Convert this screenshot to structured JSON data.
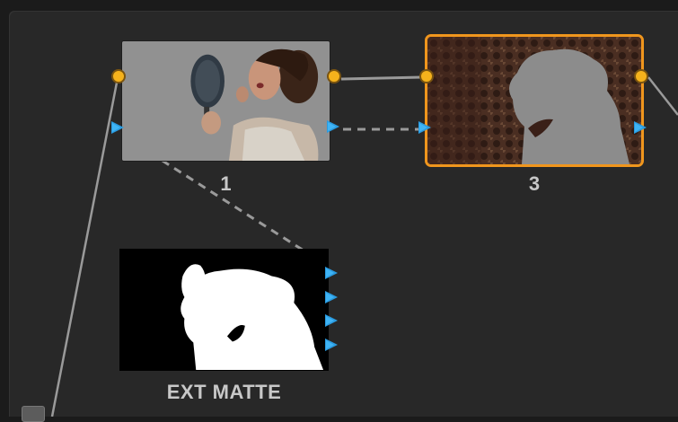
{
  "nodes": [
    {
      "id": "1",
      "label": "1"
    },
    {
      "id": "3",
      "label": "3"
    },
    {
      "id": "ext",
      "label": "EXT MATTE"
    }
  ],
  "colors": {
    "background": "#282828",
    "selected_border": "#f0961d",
    "output_port": "#f5b21c",
    "input_port": "#2a9be0",
    "wire": "#9a9a9a"
  }
}
